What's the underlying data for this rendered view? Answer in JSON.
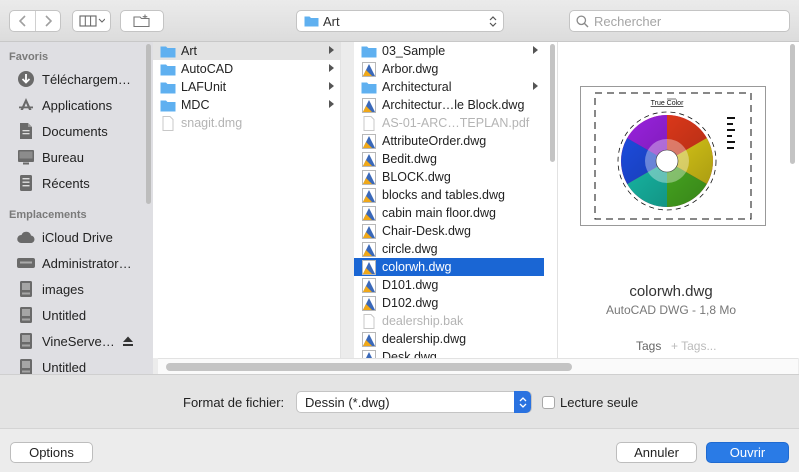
{
  "toolbar": {
    "path_label": "Art",
    "search_placeholder": "Rechercher"
  },
  "sidebar": {
    "favorites_heading": "Favoris",
    "favorites": [
      {
        "label": "Téléchargem…",
        "icon": "downloads-icon"
      },
      {
        "label": "Applications",
        "icon": "applications-icon"
      },
      {
        "label": "Documents",
        "icon": "documents-icon"
      },
      {
        "label": "Bureau",
        "icon": "desktop-icon"
      },
      {
        "label": "Récents",
        "icon": "recents-icon"
      }
    ],
    "locations_heading": "Emplacements",
    "locations": [
      {
        "label": "iCloud Drive",
        "icon": "cloud-icon"
      },
      {
        "label": "Administrator…",
        "icon": "computer-icon"
      },
      {
        "label": "images",
        "icon": "disk-icon"
      },
      {
        "label": "Untitled",
        "icon": "disk-icon"
      },
      {
        "label": "VineServe…",
        "icon": "disk-icon"
      },
      {
        "label": "Untitled",
        "icon": "disk-icon"
      }
    ]
  },
  "column1": [
    {
      "label": "Art",
      "type": "folder"
    },
    {
      "label": "AutoCAD",
      "type": "folder"
    },
    {
      "label": "LAFUnit",
      "type": "folder"
    },
    {
      "label": "MDC",
      "type": "folder"
    },
    {
      "label": "snagit.dmg",
      "type": "file"
    }
  ],
  "column2": [
    {
      "label": "03_Sample",
      "type": "folder"
    },
    {
      "label": "Arbor.dwg",
      "type": "dwg"
    },
    {
      "label": "Architectural",
      "type": "folder"
    },
    {
      "label": "Architectur…le Block.dwg",
      "type": "dwg"
    },
    {
      "label": "AS-01-ARC…TEPLAN.pdf",
      "type": "file"
    },
    {
      "label": "AttributeOrder.dwg",
      "type": "dwg"
    },
    {
      "label": "Bedit.dwg",
      "type": "dwg"
    },
    {
      "label": "BLOCK.dwg",
      "type": "dwg"
    },
    {
      "label": "blocks and tables.dwg",
      "type": "dwg"
    },
    {
      "label": "cabin main floor.dwg",
      "type": "dwg"
    },
    {
      "label": "Chair-Desk.dwg",
      "type": "dwg"
    },
    {
      "label": "circle.dwg",
      "type": "dwg"
    },
    {
      "label": "colorwh.dwg",
      "type": "dwg"
    },
    {
      "label": "D101.dwg",
      "type": "dwg"
    },
    {
      "label": "D102.dwg",
      "type": "dwg"
    },
    {
      "label": "dealership.bak",
      "type": "file"
    },
    {
      "label": "dealership.dwg",
      "type": "dwg"
    },
    {
      "label": "Desk.dwg",
      "type": "dwg"
    }
  ],
  "preview": {
    "thumb_title": "True Color",
    "file_name": "colorwh.dwg",
    "file_type": "AutoCAD DWG - 1,8 Mo",
    "tags_label": "Tags",
    "tags_placeholder": "+ Tags..."
  },
  "format": {
    "label": "Format de fichier:",
    "value": "Dessin (*.dwg)",
    "readonly_label": "Lecture seule"
  },
  "footer": {
    "options_label": "Options",
    "cancel_label": "Annuler",
    "open_label": "Ouvrir"
  },
  "colors": {
    "accent": "#1a66d4",
    "folder": "#5fb0f0",
    "sidebar_bg": "#dfdfe3"
  }
}
